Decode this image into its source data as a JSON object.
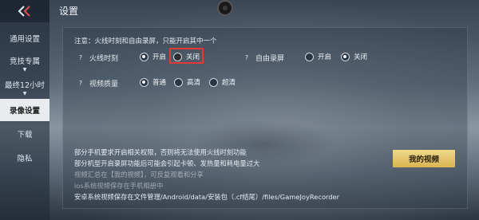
{
  "header": {
    "title": "设置"
  },
  "sidebar": {
    "items": [
      {
        "label": "通用设置"
      },
      {
        "label": "竞技专属"
      },
      {
        "label": "最终12小时"
      },
      {
        "label": "录像设置",
        "active": true
      },
      {
        "label": "下载"
      },
      {
        "label": "隐私"
      }
    ]
  },
  "settings": {
    "note": "注意：火线时刻和自由录屏，只能开启其中一个",
    "fireline": {
      "label": "火线时刻",
      "options": [
        "开启",
        "关闭"
      ],
      "selected": "开启"
    },
    "free_record": {
      "label": "自由录屏",
      "options": [
        "开启",
        "关闭"
      ],
      "selected": "关闭"
    },
    "quality": {
      "label": "视频质量",
      "options": [
        "普通",
        "高清",
        "超清"
      ],
      "selected": "普通"
    }
  },
  "info_lines": [
    "部分手机要求开启相关权限，否则将无法使用火线时刻功能",
    "部分机型开启录屏功能后可能会引起卡顿、发热量和耗电量过大",
    "视频汇总在【我的视频】，可反复观看和分享",
    "ios系统视频保存在手机相册中",
    "安卓系统视频保存在文件管理/Android/data/安装包（.cf结尾）/files/GameJoyRecorder"
  ],
  "my_video_button": "我的视频",
  "colors": {
    "highlight": "#e53935",
    "button": "#d9b552",
    "active_tab": "#e9ecef"
  }
}
